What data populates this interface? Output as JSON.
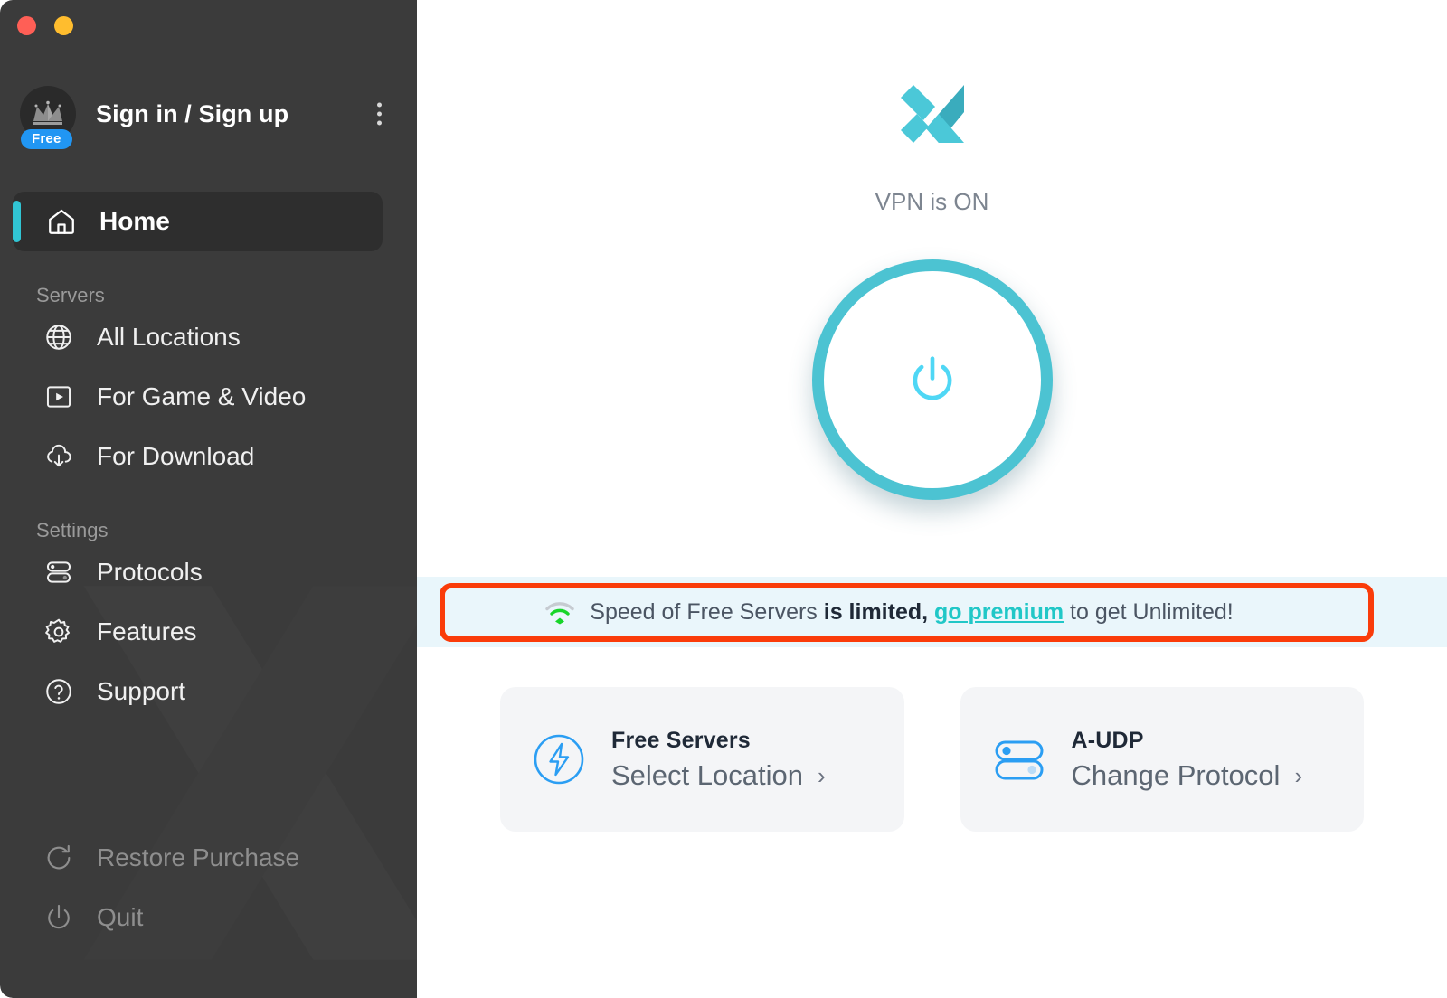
{
  "window": {
    "traffic_lights": [
      "close",
      "minimize"
    ],
    "colors": {
      "sidebar_bg": "#3b3b3b",
      "accent_teal": "#31c5d4",
      "power_ring": "#4cc3d2",
      "power_glyph": "#4fd7f5",
      "badge_blue": "#2196f3",
      "highlight_red": "#fa3c0a",
      "banner_bg": "#e9f6fb",
      "link_teal": "#21c7c7",
      "card_bg": "#f4f5f7",
      "card_icon_blue": "#2b9ef3"
    }
  },
  "sidebar": {
    "account": {
      "name": "Sign in / Sign up",
      "badge": "Free",
      "avatar_icon": "crown-icon",
      "menu_icon": "kebab-menu-icon"
    },
    "home": {
      "label": "Home",
      "icon": "home-icon",
      "active": true
    },
    "sections": [
      {
        "title": "Servers",
        "items": [
          {
            "label": "All Locations",
            "icon": "globe-icon"
          },
          {
            "label": "For Game & Video",
            "icon": "video-play-icon"
          },
          {
            "label": "For Download",
            "icon": "cloud-download-icon"
          }
        ]
      },
      {
        "title": "Settings",
        "items": [
          {
            "label": "Protocols",
            "icon": "toggles-icon"
          },
          {
            "label": "Features",
            "icon": "gear-icon"
          },
          {
            "label": "Support",
            "icon": "question-circle-icon"
          }
        ]
      }
    ],
    "bottom_items": [
      {
        "label": "Restore Purchase",
        "icon": "refresh-icon"
      },
      {
        "label": "Quit",
        "icon": "power-icon"
      }
    ]
  },
  "main": {
    "logo_icon": "x-brand-logo",
    "status_text": "VPN is ON",
    "power_button": {
      "icon": "power-icon",
      "state": "on"
    },
    "banner": {
      "icon": "wifi-icon",
      "text_part1": "Speed of Free Servers ",
      "text_bold": "is limited,",
      "link": "go premium",
      "text_part2": " to get Unlimited!"
    },
    "cards": [
      {
        "icon": "lightning-circle-icon",
        "title": "Free Servers",
        "action": "Select Location",
        "chevron": "›"
      },
      {
        "icon": "protocol-toggles-icon",
        "title": "A-UDP",
        "action": "Change Protocol",
        "chevron": "›"
      }
    ]
  }
}
